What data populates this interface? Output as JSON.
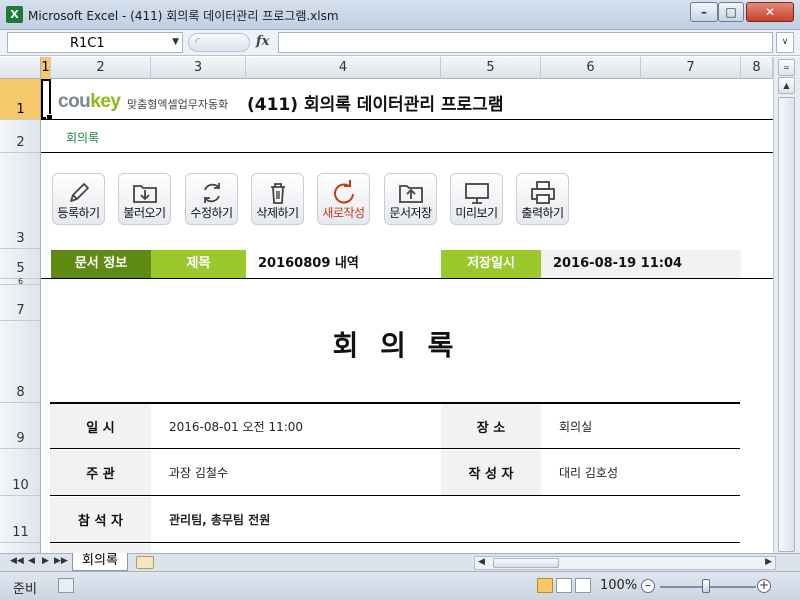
{
  "window": {
    "title": "Microsoft Excel - (411) 회의록 데이터관리 프로그램.xlsm",
    "app_icon": "X"
  },
  "formula_bar": {
    "name_box": "R1C1",
    "fx": "fx"
  },
  "columns": [
    "1",
    "2",
    "3",
    "4",
    "5",
    "6",
    "7",
    "8"
  ],
  "rows": [
    "1",
    "2",
    "3",
    "5",
    "6",
    "7",
    "8",
    "9",
    "10",
    "11"
  ],
  "sheet": {
    "brand_main": "cou",
    "brand_accent": "key",
    "brand_tagline": "맞춤형엑셀업무자동화",
    "title": "(411) 회의록 데이터관리 프로그램",
    "subtitle": "회의록",
    "toolbar": [
      {
        "label": "등록하기",
        "icon": "pencil-icon"
      },
      {
        "label": "불러오기",
        "icon": "folder-download-icon"
      },
      {
        "label": "수정하기",
        "icon": "refresh-icon"
      },
      {
        "label": "삭제하기",
        "icon": "trash-icon"
      },
      {
        "label": "새로작성",
        "icon": "new-icon"
      },
      {
        "label": "문서저장",
        "icon": "folder-upload-icon"
      },
      {
        "label": "미리보기",
        "icon": "monitor-icon"
      },
      {
        "label": "출력하기",
        "icon": "printer-icon"
      }
    ],
    "info": {
      "doc_info_label": "문서 정보",
      "subject_label": "제목",
      "subject_value": "20160809 내역",
      "saved_label": "저장일시",
      "saved_value": "2016-08-19 11:04"
    },
    "doc_title": "회 의 록",
    "table": {
      "date_label": "일  시",
      "date_value": "2016-08-01 오전 11:00",
      "place_label": "장    소",
      "place_value": "회의실",
      "host_label": "주  관",
      "host_value": "과장 김철수",
      "author_label": "작 성 자",
      "author_value": "대리 김호성",
      "attendees_label": "참 석 자",
      "attendees_value": "관리팀, 총무팀 전원"
    }
  },
  "tabs": {
    "sheet_name": "회의록"
  },
  "status": {
    "ready": "준비",
    "zoom": "100%"
  },
  "colors": {
    "dark_green": "#5f8a14",
    "light_green": "#9bc82c",
    "subtitle_green": "#1a8a3c",
    "red_label": "#c23a1c"
  }
}
